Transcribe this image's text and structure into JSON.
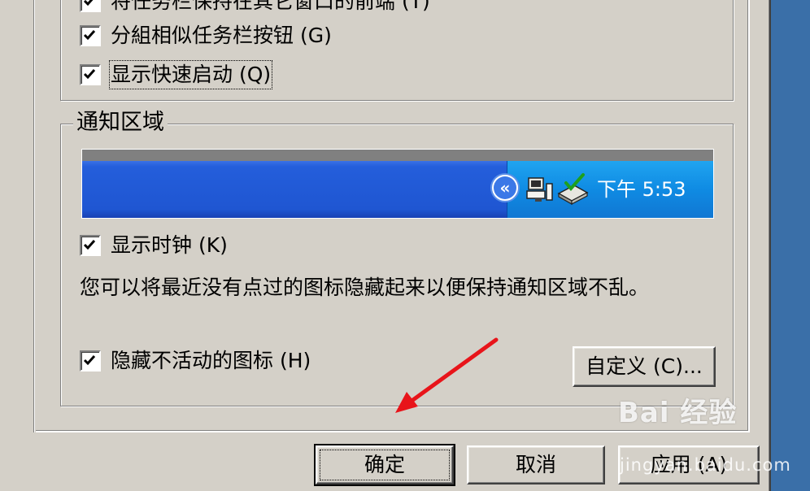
{
  "options": {
    "keep_on_top": "将任务栏保持在其它窗口的前端 (T)",
    "group_similar": "分組相似任务栏按钮 (G)",
    "quick_launch": "显示快速启动 (Q)"
  },
  "notification_area": {
    "title": "通知区域",
    "clock_text": "下午 5:53",
    "show_clock": "显示时钟 (K)",
    "info_text": "您可以将最近没有点过的图标隐藏起来以便保持通知区域不乱。",
    "hide_inactive": "隐藏不活动的图标 (H)",
    "customize_button": "自定义 (C)..."
  },
  "buttons": {
    "ok": "确定",
    "cancel": "取消",
    "apply": "应用 (A)"
  },
  "watermark": {
    "brand": "Bai 经验",
    "url": "jingyan.baidu.com"
  }
}
